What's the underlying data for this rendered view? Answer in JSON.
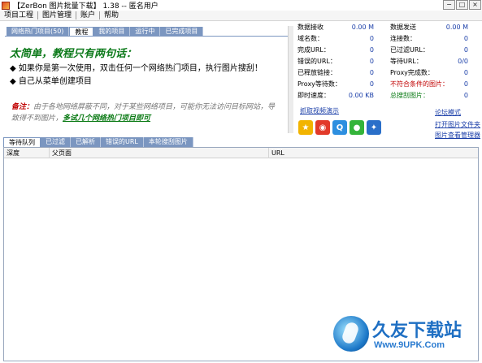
{
  "window": {
    "title": "【ZerBon 图片批量下载】 1.38 -- 匿名用户",
    "buttons": [
      "−",
      "□",
      "×"
    ]
  },
  "menu": [
    "项目工程",
    "图片管理",
    "账户",
    "帮助"
  ],
  "top_tabs": [
    "网络热门项目(50)",
    "教程",
    "我的项目",
    "运行中",
    "已完成项目"
  ],
  "active_top_tab": 1,
  "tutorial": {
    "headline": "太简单，教程只有两句话：",
    "steps": [
      "◆ 如果你是第一次使用，双击任何一个网络热门项目，执行图片搜刮！",
      "◆ 自己从菜单创建项目"
    ],
    "note_label": "备注：",
    "note_text": "由于各地网络屏蔽不同，对于某些网络项目，可能你无法访问目标网站，导致得不到图片，",
    "note_link": "多试几个网络热门项目即可"
  },
  "stats": [
    {
      "label": "数据接收",
      "value": "0.00 M"
    },
    {
      "label": "数据发送",
      "value": "0.00 M"
    },
    {
      "label": "域名数：",
      "value": "0"
    },
    {
      "label": "连接数：",
      "value": "0"
    },
    {
      "label": "完成URL：",
      "value": "0"
    },
    {
      "label": "已过滤URL：",
      "value": "0"
    },
    {
      "label": "错误的URL：",
      "value": "0"
    },
    {
      "label": "等待URL：",
      "value": "0/0"
    },
    {
      "label": "已释放链接：",
      "value": "0"
    },
    {
      "label": "Proxy完成数：",
      "value": "0"
    },
    {
      "label": "Proxy等待数：",
      "value": "0"
    },
    {
      "label": "不符合条件的图片：",
      "value": "0"
    },
    {
      "label": "即时速度：",
      "value": "0.00 KB"
    },
    {
      "label": "总搜刮图片：",
      "value": "0"
    }
  ],
  "links": {
    "video_demo": "抓取视频演示",
    "forum_mode": "论坛模式",
    "open_folder": "打开图片文件夹",
    "image_manager": "图片查看管理器"
  },
  "share_icons": [
    "qzone-icon",
    "weibo-icon",
    "qq-icon",
    "wechat-icon",
    "tencent-weibo-icon"
  ],
  "colors": {
    "tab_blue": "#7b96c0",
    "link_blue": "#1a3ea8",
    "headline_green": "#0c7a1a",
    "alert_red": "#c00000"
  },
  "bottom_tabs": [
    "等待队列",
    "已过滤",
    "已解析",
    "错误的URL",
    "本轮搜刮图片"
  ],
  "active_bottom_tab": 0,
  "list_columns": [
    "深度",
    "父页面",
    "URL"
  ],
  "watermark": {
    "title": "久友下载站",
    "url": "Www.9UPK.Com"
  }
}
